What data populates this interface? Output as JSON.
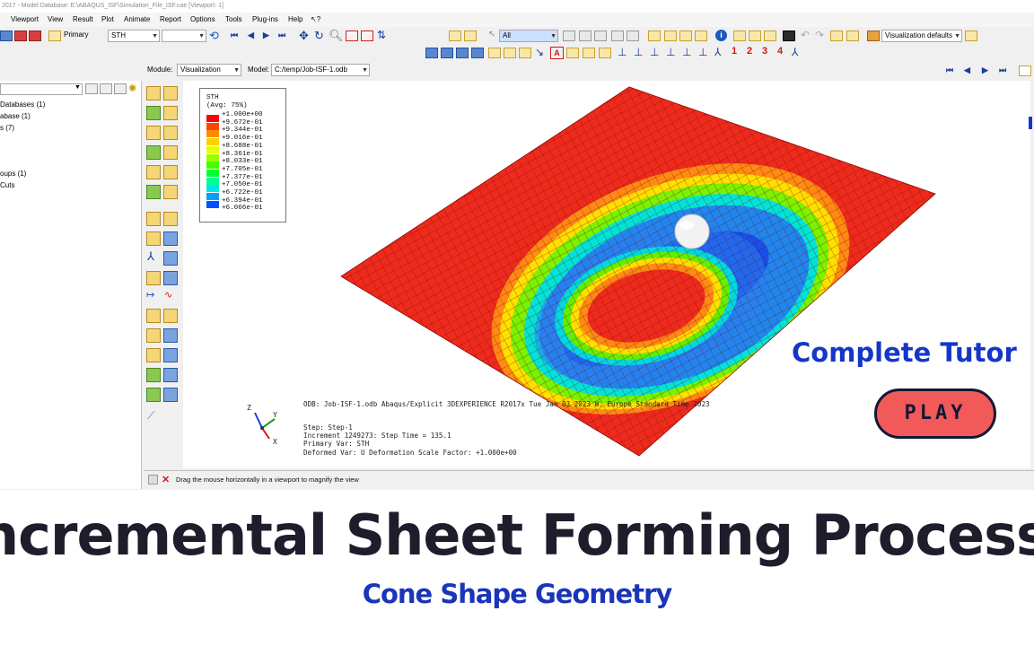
{
  "window": {
    "title": "2017 - Model Database: E:\\ABAQUS_ISF\\Simulation_File_ISF.cae [Viewport: 1]"
  },
  "menu": [
    {
      "label": "Viewport"
    },
    {
      "label": "View"
    },
    {
      "label": "Result"
    },
    {
      "label": "Plot"
    },
    {
      "label": "Animate"
    },
    {
      "label": "Report"
    },
    {
      "label": "Options"
    },
    {
      "label": "Tools"
    },
    {
      "label": "Plug-ins"
    },
    {
      "label": "Help"
    },
    {
      "label": "↖?"
    }
  ],
  "toolbar": {
    "primary_label": "Primary",
    "field_output_value": "STH",
    "component_value": "",
    "filter_value": "All",
    "visualization_defaults": "Visualization defaults",
    "viewport_numbers": [
      "1",
      "2",
      "3",
      "4"
    ]
  },
  "context": {
    "module_label": "Module:",
    "module_value": "Visualization",
    "model_label": "Model:",
    "model_value": "C:/temp/Job-ISF-1.odb"
  },
  "tree": {
    "items": [
      {
        "label": "Databases (1)"
      },
      {
        "label": "abase (1)"
      },
      {
        "label": "s (7)"
      },
      {
        "label": "oups (1)"
      },
      {
        "label": "Cuts"
      }
    ]
  },
  "legend": {
    "title": "STH",
    "subtitle": "(Avg: 75%)",
    "entries": [
      {
        "value": "+1.000e+00",
        "color": "#ff0000"
      },
      {
        "value": "+9.672e-01",
        "color": "#ff4600"
      },
      {
        "value": "+9.344e-01",
        "color": "#ff8c00"
      },
      {
        "value": "+9.016e-01",
        "color": "#ffd200"
      },
      {
        "value": "+8.688e-01",
        "color": "#e6ff00"
      },
      {
        "value": "+8.361e-01",
        "color": "#9bff00"
      },
      {
        "value": "+8.033e-01",
        "color": "#46ff00"
      },
      {
        "value": "+7.705e-01",
        "color": "#00ff32"
      },
      {
        "value": "+7.377e-01",
        "color": "#00ff96"
      },
      {
        "value": "+7.050e-01",
        "color": "#00e6e6"
      },
      {
        "value": "+6.722e-01",
        "color": "#00a0ff"
      },
      {
        "value": "+6.394e-01",
        "color": "#0050ff"
      },
      {
        "value": "+6.066e-01",
        "color": "#0000ff"
      }
    ]
  },
  "odb_info": {
    "line1": "ODB: Job-ISF-1.odb    Abaqus/Explicit 3DEXPERIENCE R2017x    Tue Jan 03 2023 W. Europe Standard Time 2023",
    "step": "Step: Step-1",
    "increment": "Increment  1249273: Step Time =    135.1",
    "primary_var": "Primary Var: STH",
    "deformed_var": "Deformed Var: U   Deformation Scale Factor: +1.000e+00"
  },
  "triad": {
    "z": "Z",
    "y": "Y",
    "x": "X"
  },
  "status": {
    "message": "Drag the mouse horizontally in a viewport to magnify the view"
  },
  "promo": {
    "headline": "Complete Tutor",
    "play_label": "PLAY"
  },
  "banner": {
    "title": "ncremental Sheet Forming Process",
    "subtitle": "Cone Shape Geometry"
  },
  "colors": {
    "sheet_red": "#ee2a1c",
    "accent_blue": "#1636c8",
    "play_button": "#f25a5a",
    "banner_text": "#1d1d2b"
  }
}
